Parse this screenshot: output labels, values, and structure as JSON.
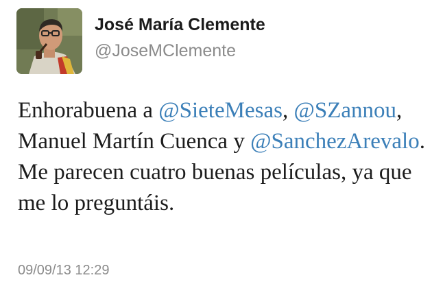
{
  "tweet": {
    "author": {
      "display_name": "José María Clemente",
      "handle": "@JoseMClemente",
      "avatar_icon": "profile-photo"
    },
    "text_parts": {
      "p1": "Enhorabuena a ",
      "m1": "@SieteMesas",
      "p2": ", ",
      "m2": "@SZannou",
      "p3": ", Manuel Martín Cuenca y ",
      "m3": "@SanchezArevalo",
      "p4": ". Me parecen cuatro buenas películas, ya que me lo preguntáis."
    },
    "timestamp": "09/09/13 12:29"
  },
  "colors": {
    "mention": "#3b7fb8",
    "name": "#1a1a1a",
    "secondary": "#8a8a8a",
    "body_text": "#1c1c1c"
  }
}
